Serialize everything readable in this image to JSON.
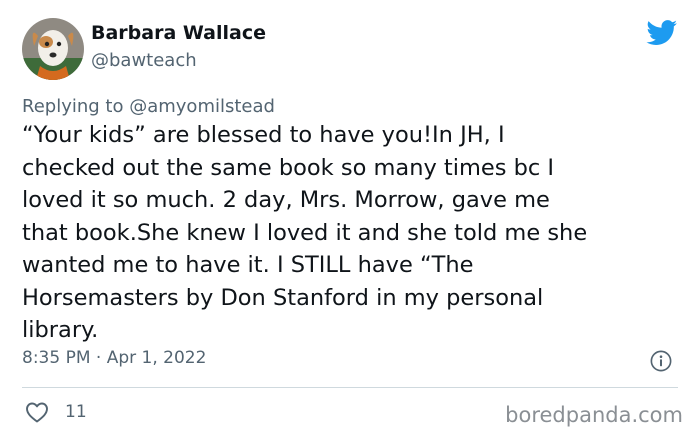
{
  "author": {
    "name": "Barbara Wallace",
    "handle": "@bawteach"
  },
  "reply": {
    "prefix": "Replying to",
    "mention": "@amyomilstead"
  },
  "tweet": {
    "text": "“Your kids” are blessed to have you!In JH, I\nchecked out the same book so many times bc I\nloved it so much. 2 day, Mrs. Morrow, gave me\nthat book.She knew I loved it and she told me she\nwanted me to have it. I STILL have “The\nHorsemasters by Don Stanford in my personal\nlibrary.",
    "timestamp": "8:35 PM · Apr 1, 2022",
    "likes": "11"
  },
  "watermark": "boredpanda.com",
  "colors": {
    "twitter_blue": "#1d9bf0",
    "secondary_text": "#536471"
  },
  "icons": {
    "brand": "twitter-bird-icon",
    "info": "info-icon",
    "like": "heart-icon"
  }
}
